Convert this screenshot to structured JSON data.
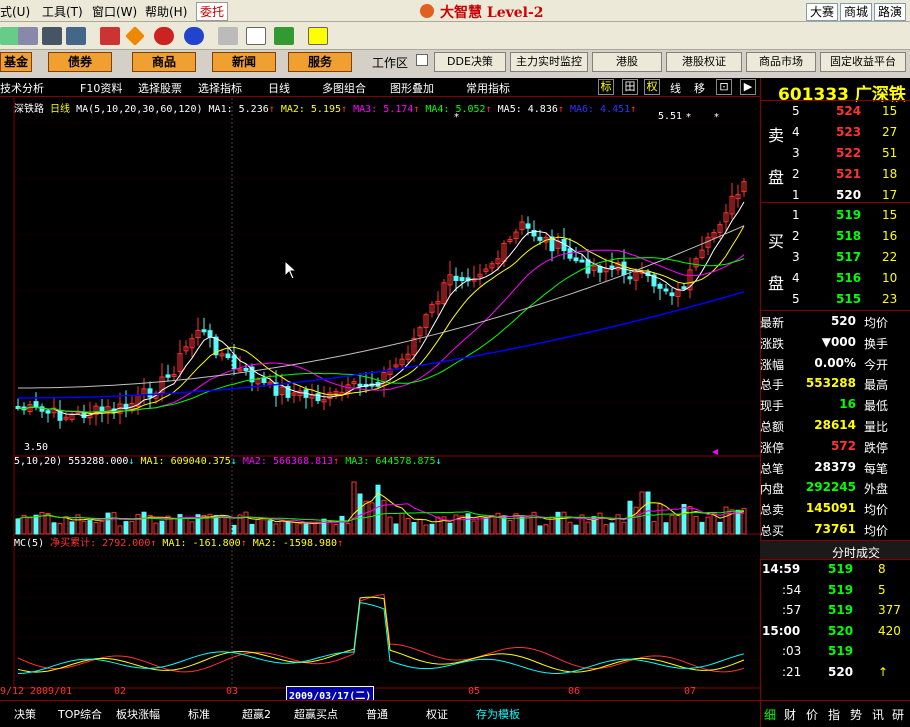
{
  "menu": {
    "items": [
      "式(U)",
      "工具(T)",
      "窗口(W)",
      "帮助(H)"
    ],
    "wt": "委托",
    "app_title": "大智慧 Level-2",
    "right_btns": [
      "大赛",
      "商城",
      "路演"
    ]
  },
  "nav": {
    "buttons": [
      "基金",
      "债券",
      "商品",
      "新闻",
      "服务"
    ],
    "workarea": "工作区",
    "right_buttons": [
      "DDE决策",
      "主力实时监控",
      "港股",
      "港股权证",
      "商品市场",
      "固定收益平台"
    ]
  },
  "tabs": {
    "items": [
      "技术分析",
      "F10资料",
      "选择股票",
      "选择指标",
      "日线",
      "多图组合",
      "图形叠加",
      "常用指标"
    ],
    "right_icons": [
      "标",
      "田",
      "权",
      "线",
      "移",
      "⊡",
      "▶"
    ]
  },
  "legend1": {
    "name": "深铁路",
    "period": "日线",
    "ma_params": "MA(5,10,20,30,60,120)",
    "ma1": "MA1: 5.236",
    "ma2": "MA2: 5.195",
    "ma3": "MA3: 5.174",
    "ma4": "MA4: 5.052",
    "ma5": "MA5: 4.836",
    "ma6": "MA6: 4.451"
  },
  "price_labels": {
    "high": "5.51",
    "low": "3.50"
  },
  "legend2": {
    "params": "5,10,20)",
    "vol": "553288.000",
    "ma1": "MA1: 609040.375",
    "ma2": "MA2: 566368.813",
    "ma3": "MA3: 644578.875"
  },
  "legend3": {
    "params": "MC(5)",
    "name": "净买累计: 2792.000",
    "ma1": "MA1: -161.800",
    "ma2": "MA2: -1598.980"
  },
  "xaxis": {
    "labels": [
      "9/12",
      "2009/01",
      "02",
      "03",
      "05",
      "06",
      "07"
    ],
    "cursor_date": "2009/03/17(二)"
  },
  "bottom_tabs": [
    "决策",
    "TOP综合",
    "板块涨幅",
    "标准",
    "超赢2",
    "超赢买点",
    "普通",
    "权证",
    "存为模板"
  ],
  "stock": {
    "code": "601333",
    "name": "广深铁"
  },
  "sell": {
    "label1": "卖",
    "label2": "盘",
    "rows": [
      {
        "n": "5",
        "p": "524",
        "v": "15"
      },
      {
        "n": "4",
        "p": "523",
        "v": "27"
      },
      {
        "n": "3",
        "p": "522",
        "v": "51"
      },
      {
        "n": "2",
        "p": "521",
        "v": "18"
      },
      {
        "n": "1",
        "p": "520",
        "v": "17"
      }
    ]
  },
  "buy": {
    "label1": "买",
    "label2": "盘",
    "rows": [
      {
        "n": "1",
        "p": "519",
        "v": "15"
      },
      {
        "n": "2",
        "p": "518",
        "v": "16"
      },
      {
        "n": "3",
        "p": "517",
        "v": "22"
      },
      {
        "n": "4",
        "p": "516",
        "v": "10"
      },
      {
        "n": "5",
        "p": "515",
        "v": "23"
      }
    ]
  },
  "stats": [
    {
      "k": "最新",
      "v": "520",
      "k2": "均价"
    },
    {
      "k": "涨跌",
      "v": "▼000",
      "k2": "换手"
    },
    {
      "k": "涨幅",
      "v": "0.00%",
      "k2": "今开"
    },
    {
      "k": "总手",
      "v": "553288",
      "k2": "最高"
    },
    {
      "k": "现手",
      "v": "16",
      "k2": "最低"
    },
    {
      "k": "总额",
      "v": "28614",
      "k2": "量比"
    },
    {
      "k": "涨停",
      "v": "572",
      "k2": "跌停"
    },
    {
      "k": "总笔",
      "v": "28379",
      "k2": "每笔"
    },
    {
      "k": "内盘",
      "v": "292245",
      "k2": "外盘"
    },
    {
      "k": "总卖",
      "v": "145091",
      "k2": "均价"
    },
    {
      "k": "总买",
      "v": "73761",
      "k2": "均价"
    }
  ],
  "ticks": {
    "title": "分时成交",
    "rows": [
      {
        "t": "14:59",
        "p": "519",
        "v": "8"
      },
      {
        "t": ":54",
        "p": "519",
        "v": "5"
      },
      {
        "t": ":57",
        "p": "519",
        "v": "377"
      },
      {
        "t": "15:00",
        "p": "520",
        "v": "420"
      },
      {
        "t": ":03",
        "p": "519",
        "v": ""
      },
      {
        "t": ":21",
        "p": "520",
        "v": "↑"
      }
    ]
  },
  "right_tabs": [
    "细",
    "财",
    "价",
    "指",
    "势",
    "讯",
    "研"
  ],
  "colors": {
    "up": "#ff3232",
    "down": "#54fcfc",
    "ma1": "#ffffff",
    "ma2": "#ffff00",
    "ma3": "#ff00ff",
    "ma4": "#00ff00",
    "ma5": "#c0c0c0",
    "ma6": "#0000ff"
  }
}
